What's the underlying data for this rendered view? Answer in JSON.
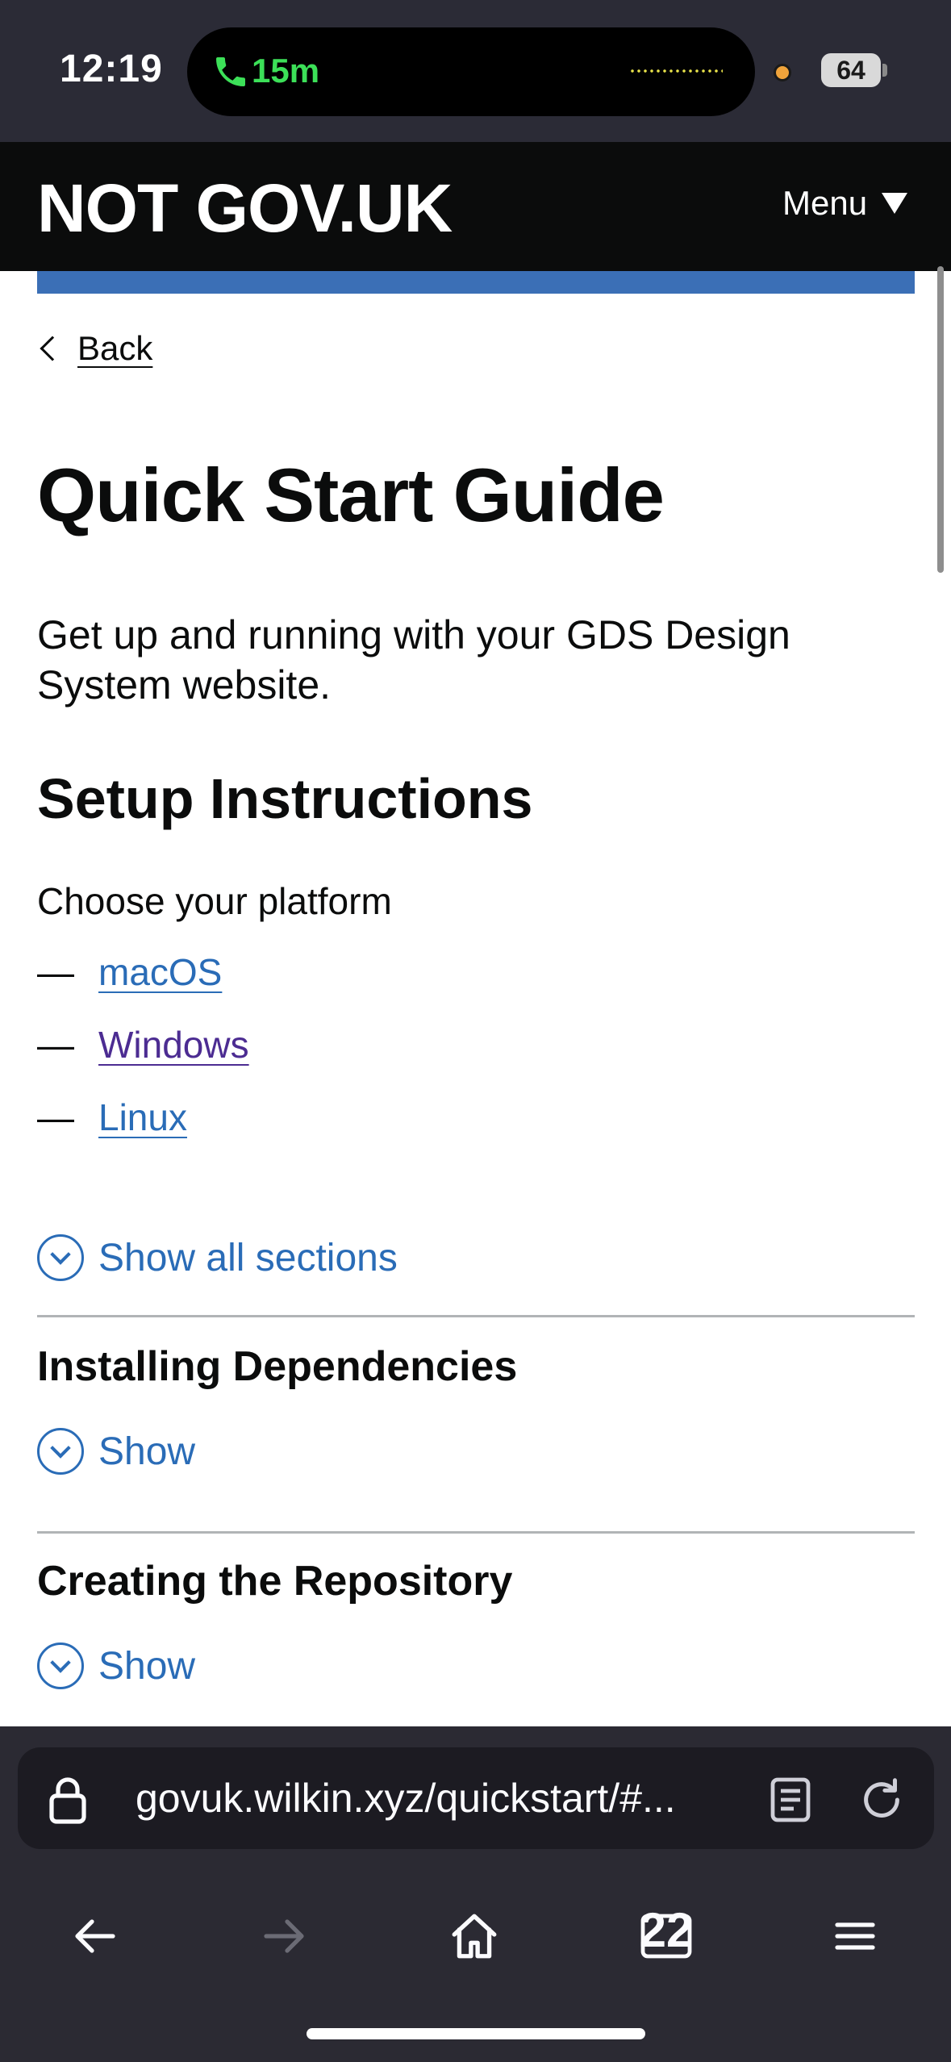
{
  "status_bar": {
    "time": "12:19",
    "call_duration": "15m",
    "battery": "64"
  },
  "header": {
    "logo": "NOT GOV.UK",
    "menu_label": "Menu"
  },
  "content": {
    "back_label": "Back",
    "title": "Quick Start Guide",
    "lead": "Get up and running with your GDS Design System website.",
    "setup_heading": "Setup Instructions",
    "choose_text": "Choose your platform",
    "dash": "—",
    "platforms": [
      {
        "label": "macOS"
      },
      {
        "label": "Windows"
      },
      {
        "label": "Linux"
      }
    ],
    "show_all_label": "Show all sections",
    "sections": [
      {
        "heading": "Installing Dependencies",
        "show_label": "Show"
      },
      {
        "heading": "Creating the Repository",
        "show_label": "Show"
      }
    ]
  },
  "browser": {
    "url": "govuk.wilkin.xyz/quickstart/#...",
    "tab_count": "22"
  },
  "colors": {
    "header_bg": "#0b0c0c",
    "accent_bar": "#3b6fb6",
    "link": "#2a6cb7",
    "visited_link": "#4c2c92",
    "browser_bg": "#2b2a33"
  }
}
